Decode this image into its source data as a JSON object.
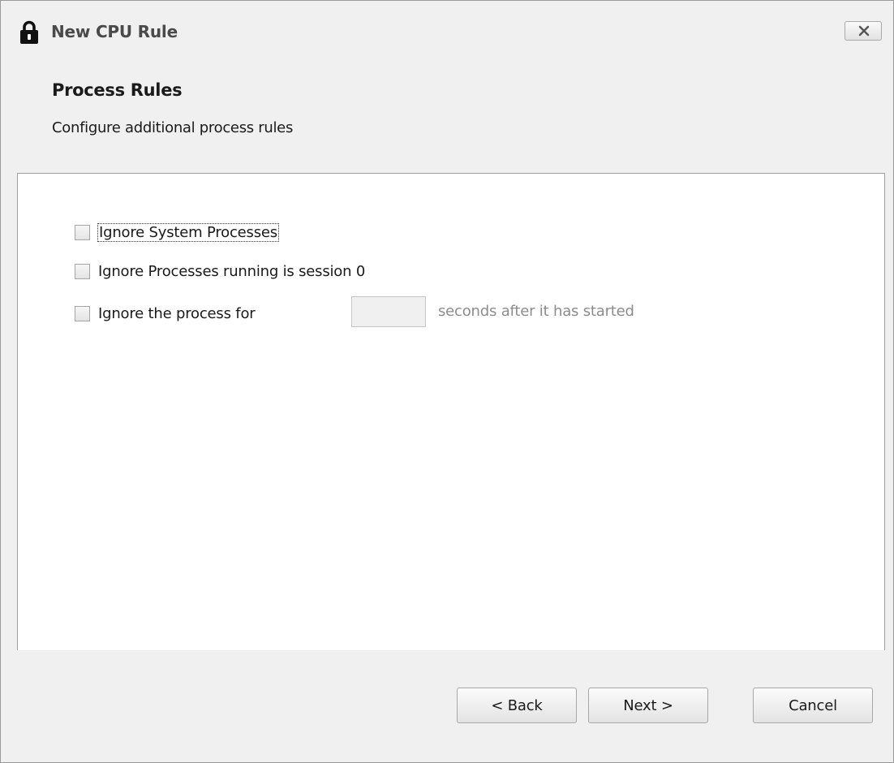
{
  "window": {
    "title": "New CPU Rule"
  },
  "header": {
    "title": "Process Rules",
    "subtitle": "Configure additional process rules"
  },
  "options": {
    "ignore_system": {
      "label": "Ignore System Processes",
      "checked": false
    },
    "ignore_session0": {
      "label": "Ignore Processes running is session 0",
      "checked": false
    },
    "ignore_delay": {
      "label": "Ignore the process for",
      "checked": false,
      "seconds_value": "",
      "suffix": "seconds after it has started"
    }
  },
  "footer": {
    "back_label": "< Back",
    "next_label": "Next >",
    "cancel_label": "Cancel"
  },
  "icons": {
    "title": "lock-icon",
    "close": "close-icon"
  }
}
